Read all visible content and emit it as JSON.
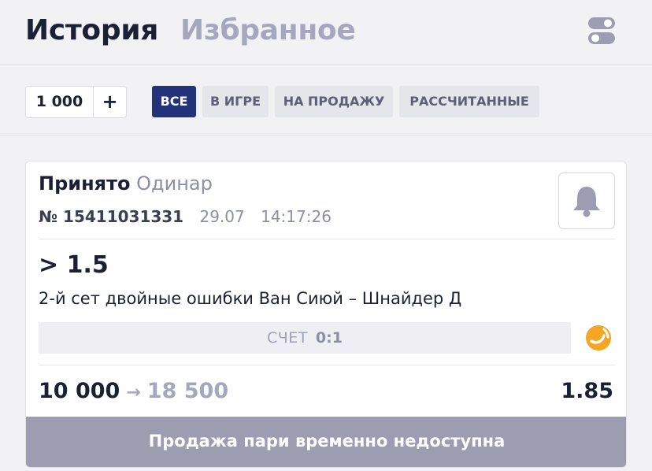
{
  "header": {
    "tabs": [
      {
        "label": "История",
        "active": true
      },
      {
        "label": "Избранное",
        "active": false
      }
    ],
    "settings_icon": "toggle-settings-icon"
  },
  "filters": {
    "stake_value": "1 000",
    "stake_plus": "+",
    "chips": [
      {
        "label": "ВСЕ",
        "active": true
      },
      {
        "label": "В ИГРЕ",
        "active": false
      },
      {
        "label": "НА ПРОДАЖУ",
        "active": false
      },
      {
        "label": "РАССЧИТАННЫЕ",
        "active": false
      }
    ]
  },
  "bet": {
    "status": "Принято",
    "type": "Одинар",
    "number": "№ 15411031331",
    "date": "29.07",
    "time": "14:17:26",
    "outcome": "> 1.5",
    "market": "2-й сет двойные ошибки Ван Сиюй – Шнайдер Д",
    "score_label": "СЧЕТ",
    "score_value": "0:1",
    "stake": "10 000",
    "arrow": "→",
    "potential_win": "18 500",
    "coefficient": "1.85",
    "sell_label": "Продажа пари временно недоступна",
    "bell_icon": "bell-icon",
    "sport_icon": "tennis-ball-icon"
  },
  "colors": {
    "primary_dark": "#22337a",
    "text": "#1c2035",
    "muted": "#a5a7bf",
    "accent_orange": "#f5a623",
    "sell_bar": "#9c9db1"
  }
}
